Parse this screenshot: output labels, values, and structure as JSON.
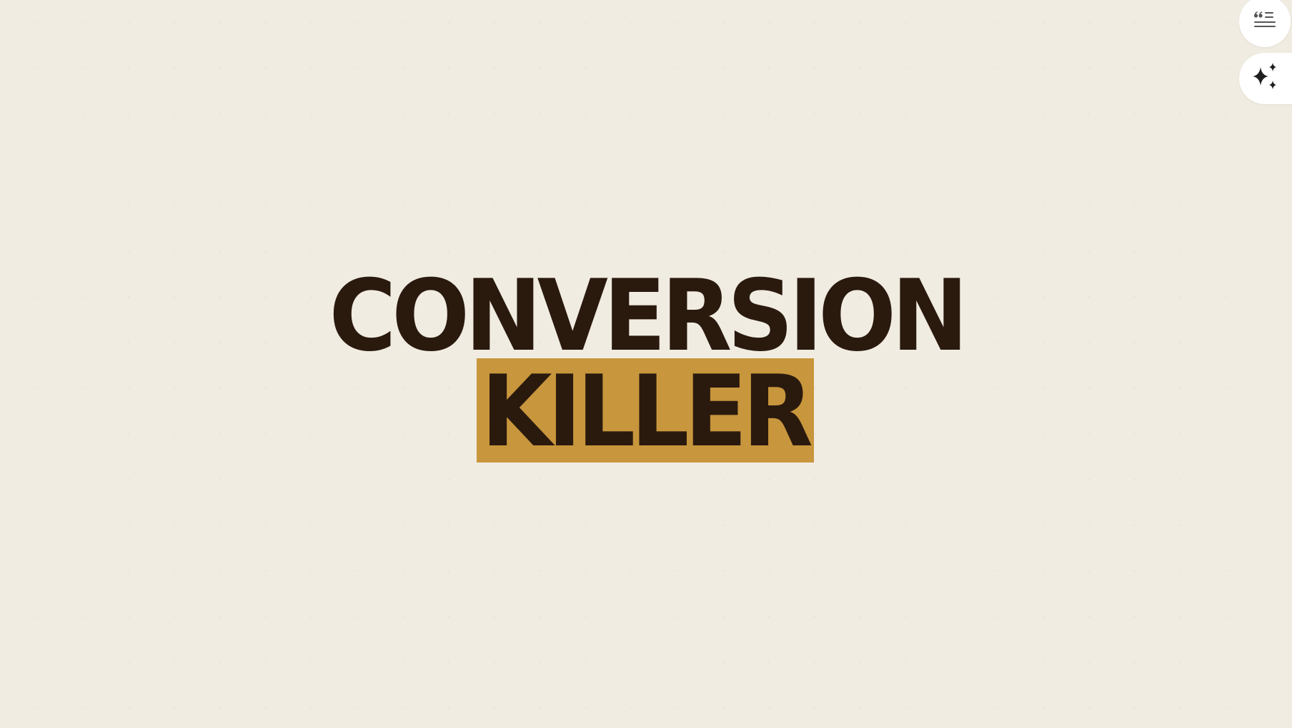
{
  "headline": {
    "line1": "CONVERSION",
    "line2": "KILLER"
  },
  "controls": {
    "menu_icon": "quote-list-icon",
    "ai_icon": "sparkles-icon"
  },
  "colors": {
    "background": "#f1ece2",
    "text": "#2a1a0e",
    "highlight": "#c8963c",
    "button_bg": "#ffffff",
    "icon_gray": "#555555",
    "icon_dark": "#1f1f1f"
  }
}
